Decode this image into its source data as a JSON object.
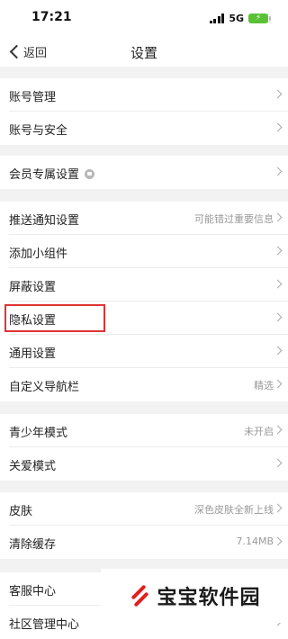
{
  "status_bar": {
    "time": "17:21",
    "network": "5G",
    "battery_charging": true
  },
  "nav": {
    "back_label": "返回",
    "title": "设置"
  },
  "rows": [
    {
      "label": "账号管理",
      "value": ""
    },
    {
      "label": "账号与安全",
      "value": ""
    },
    {
      "label": "会员专属设置",
      "value": ""
    },
    {
      "label": "推送通知设置",
      "value": "可能错过重要信息"
    },
    {
      "label": "添加小组件",
      "value": ""
    },
    {
      "label": "屏蔽设置",
      "value": ""
    },
    {
      "label": "隐私设置",
      "value": ""
    },
    {
      "label": "通用设置",
      "value": ""
    },
    {
      "label": "自定义导航栏",
      "value": "精选"
    },
    {
      "label": "青少年模式",
      "value": "未开启"
    },
    {
      "label": "关爱模式",
      "value": ""
    },
    {
      "label": "皮肤",
      "value": "深色皮肤全新上线"
    },
    {
      "label": "清除缓存",
      "value": "7.14MB"
    },
    {
      "label": "客服中心",
      "value": ""
    },
    {
      "label": "社区管理中心",
      "value": ""
    }
  ],
  "highlighted_item": "隐私设置",
  "watermark": {
    "text": "宝宝软件园"
  },
  "colors": {
    "highlight": "#e03333",
    "background": "#f2f2f2",
    "watermark_logo": "#e01f1f"
  }
}
